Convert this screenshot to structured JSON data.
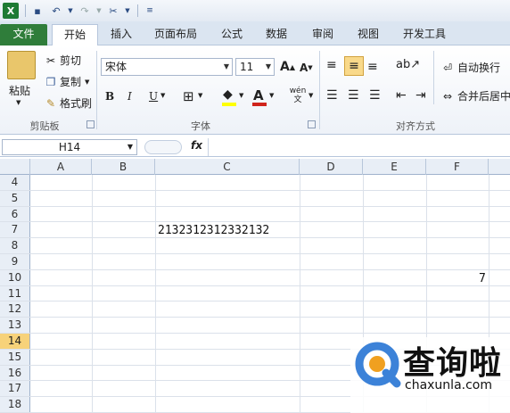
{
  "qat": {
    "excel_icon": "X"
  },
  "tabs": [
    "文件",
    "开始",
    "插入",
    "页面布局",
    "公式",
    "数据",
    "审阅",
    "视图",
    "开发工具"
  ],
  "clipboard": {
    "paste": "粘贴",
    "cut": "剪切",
    "copy": "复制",
    "format_painter": "格式刷",
    "group": "剪贴板"
  },
  "font": {
    "name": "宋体",
    "size": "11",
    "group": "字体",
    "bold": "B",
    "italic": "I",
    "underline": "U",
    "wen": "wén 文"
  },
  "alignment": {
    "wrap": "自动换行",
    "merge": "合并后居中",
    "group": "对齐方式"
  },
  "formula_bar": {
    "name_box": "H14",
    "fx": "fx",
    "formula": ""
  },
  "columns": [
    "A",
    "B",
    "C",
    "D",
    "E",
    "F"
  ],
  "rows": [
    "4",
    "5",
    "6",
    "7",
    "8",
    "9",
    "10",
    "11",
    "12",
    "13",
    "14",
    "15",
    "16",
    "17",
    "18"
  ],
  "active_row": "14",
  "cells": {
    "C7": "2132312312332132",
    "F10": "7"
  },
  "watermark": {
    "name": "查询啦",
    "url": "chaxunla.com"
  }
}
